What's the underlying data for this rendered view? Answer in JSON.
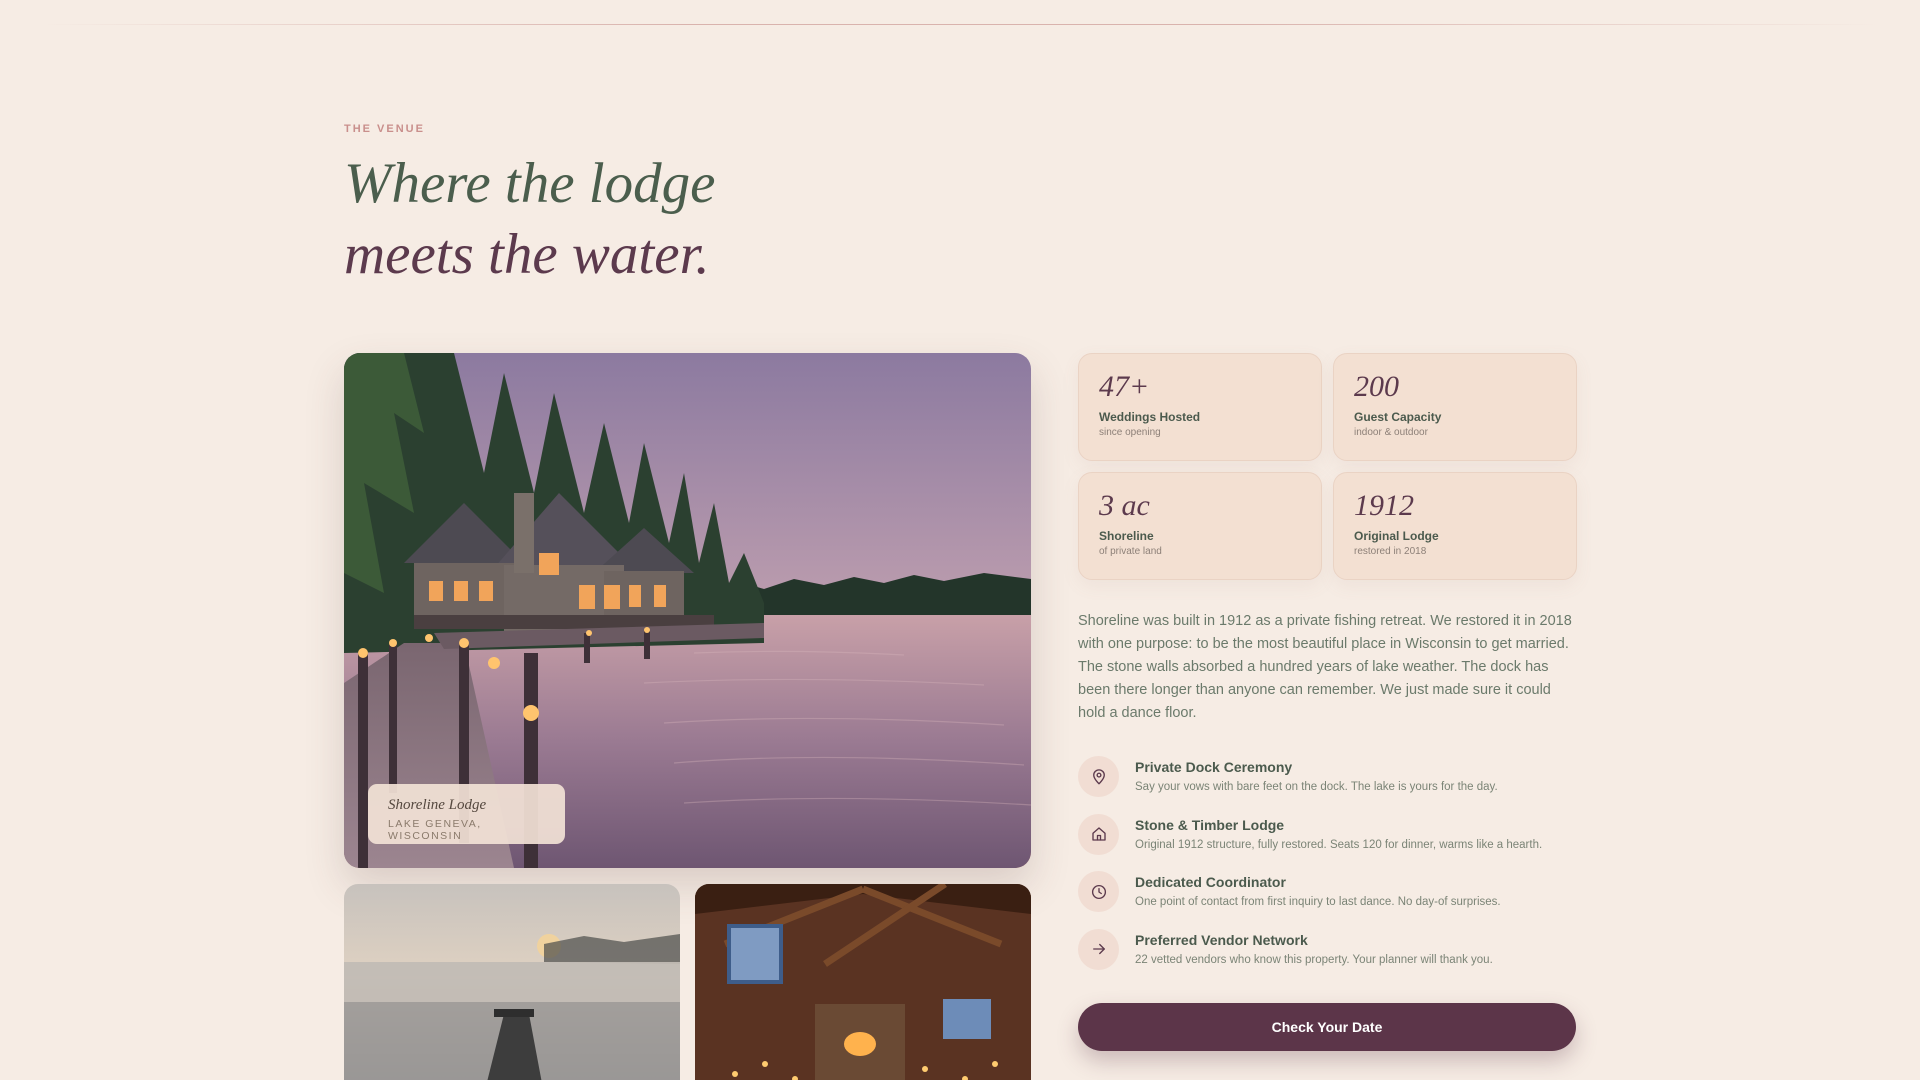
{
  "section": {
    "eyebrow": "THE VENUE",
    "headline_line1": "Where the lodge",
    "headline_line2": "meets the water."
  },
  "hero": {
    "caption_name": "Shoreline Lodge",
    "caption_location": "LAKE GENEVA, WISCONSIN"
  },
  "stats": [
    {
      "value": "47+",
      "label": "Weddings Hosted",
      "sub": "since opening"
    },
    {
      "value": "200",
      "label": "Guest Capacity",
      "sub": "indoor & outdoor"
    },
    {
      "value": "3 ac",
      "label": "Shoreline",
      "sub": "of private land"
    },
    {
      "value": "1912",
      "label": "Original Lodge",
      "sub": "restored in 2018"
    }
  ],
  "description": "Shoreline was built in 1912 as a private fishing retreat. We restored it in 2018 with one purpose: to be the most beautiful place in Wisconsin to get married. The stone walls absorbed a hundred years of lake weather. The dock has been there longer than anyone can remember. We just made sure it could hold a dance floor.",
  "features": [
    {
      "icon": "map-pin-icon",
      "title": "Private Dock Ceremony",
      "text": "Say your vows with bare feet on the dock. The lake is yours for the day."
    },
    {
      "icon": "home-icon",
      "title": "Stone & Timber Lodge",
      "text": "Original 1912 structure, fully restored. Seats 120 for dinner, warms like a hearth."
    },
    {
      "icon": "clock-icon",
      "title": "Dedicated Coordinator",
      "text": "One point of contact from first inquiry to last dance. No day-of surprises."
    },
    {
      "icon": "arrow-right-icon",
      "title": "Preferred Vendor Network",
      "text": "22 vetted vendors who know this property. Your planner will thank you."
    }
  ],
  "cta": {
    "label": "Check Your Date"
  },
  "colors": {
    "background": "#f6ece4",
    "sage": "#4b5e4d",
    "plum": "#5c3a4d",
    "accent_rose": "#c98f8c",
    "button": "#5c3549"
  }
}
